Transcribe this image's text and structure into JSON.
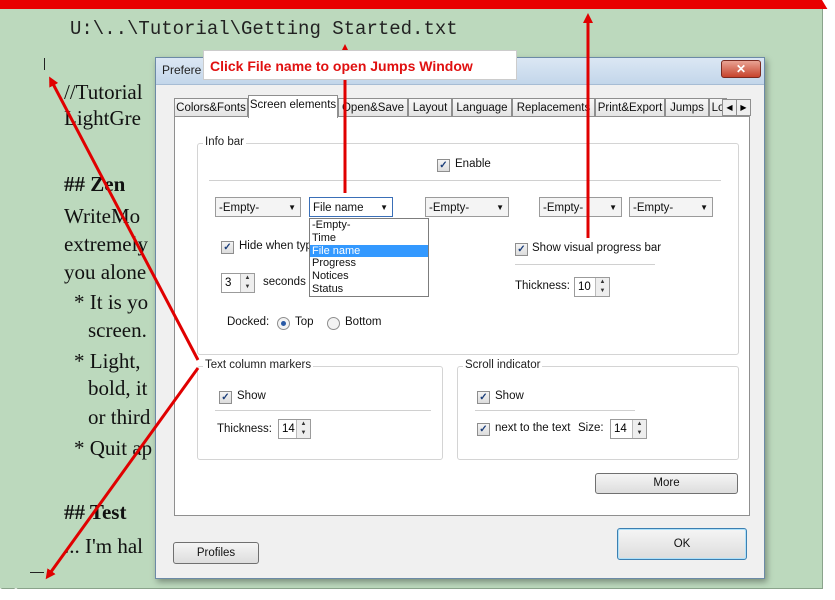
{
  "editor": {
    "path": "U:\\..\\Tutorial\\Getting Started.txt",
    "lines": [
      "//Tutorial",
      "LightGre",
      "## Zen",
      "WriteMo",
      "extremely",
      "you alone",
      "* It is yo",
      "screen.",
      "* Light,",
      "bold, it",
      "or third",
      "* Quit ap",
      "## Test",
      "... I'm hal"
    ]
  },
  "annotation": {
    "callout": "Click File name to open Jumps Window"
  },
  "dialog": {
    "title": "Prefere",
    "close": "✕",
    "tabs": [
      "Colors&Fonts",
      "Screen elements",
      "Open&Save",
      "Layout",
      "Language",
      "Replacements",
      "Print&Export",
      "Jumps",
      "Lo"
    ],
    "tab_scroll_left": "◀",
    "tab_scroll_right": "▶",
    "infobar": {
      "label": "Info bar",
      "enable": "Enable",
      "combos": [
        "-Empty-",
        "File name",
        "-Empty-",
        "-Empty-",
        "-Empty-"
      ],
      "dropdown_options": [
        "-Empty-",
        "Time",
        "File name",
        "Progress",
        "Notices",
        "Status"
      ],
      "dropdown_selected": "File name",
      "hide_when_typing": "Hide when typi",
      "seconds_value": "3",
      "seconds_label": "seconds c",
      "docked_label": "Docked:",
      "docked_top": "Top",
      "docked_bottom": "Bottom",
      "show_progress": "Show visual progress bar",
      "thickness_label": "Thickness:",
      "thickness_value": "10"
    },
    "text_column_markers": {
      "label": "Text column markers",
      "show": "Show",
      "thickness_label": "Thickness:",
      "thickness_value": "14"
    },
    "scroll_indicator": {
      "label": "Scroll indicator",
      "show": "Show",
      "next_to_text": "next to the text",
      "size_label": "Size:",
      "size_value": "14"
    },
    "more_button": "More",
    "profiles_button": "Profiles",
    "ok_button": "OK",
    "check_mark": "✓",
    "spin_up": "▲",
    "spin_down": "▼",
    "combo_arrow": "▼"
  }
}
